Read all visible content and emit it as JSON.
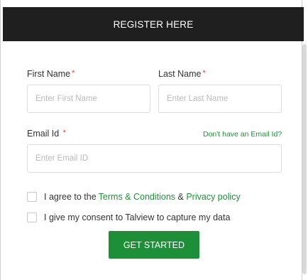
{
  "header": {
    "title": "REGISTER HERE"
  },
  "form": {
    "first_name": {
      "label": "First Name",
      "required_mark": "*",
      "placeholder": "Enter First Name",
      "value": ""
    },
    "last_name": {
      "label": "Last Name",
      "required_mark": "*",
      "placeholder": "Enter Last Name",
      "value": ""
    },
    "email": {
      "label": "Email Id",
      "required_mark": "*",
      "placeholder": "Enter Email ID",
      "value": "",
      "help_link": "Don't have an Email Id?"
    },
    "terms": {
      "prefix": "I agree to the ",
      "terms_link": "Terms & Conditions",
      "joiner": " & ",
      "privacy_link": "Privacy policy",
      "checked": false
    },
    "consent": {
      "label": "I give my consent to Talview to capture my data",
      "checked": false
    },
    "submit_label": "GET STARTED"
  },
  "colors": {
    "header_bg": "#1f1f1f",
    "accent": "#1e8f39",
    "required": "#e53935"
  }
}
